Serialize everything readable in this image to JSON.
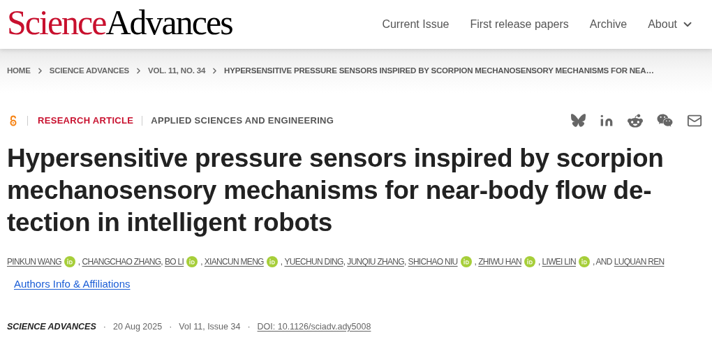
{
  "logo": {
    "part_1": "Science",
    "part_2": "Advances"
  },
  "nav": [
    {
      "label": "Current Issue",
      "dropdown": false
    },
    {
      "label": "First release papers",
      "dropdown": false
    },
    {
      "label": "Archive",
      "dropdown": false
    },
    {
      "label": "About",
      "dropdown": true
    }
  ],
  "breadcrumb": [
    "HOME",
    "SCIENCE ADVANCES",
    "VOL. 11, NO. 34",
    "HYPERSENSITIVE PRESSURE SENSORS INSPIRED BY SCORPION MECHANOSENSORY MECHANISMS FOR NEA…"
  ],
  "article_type": "RESEARCH ARTICLE",
  "subject": "APPLIED SCIENCES AND ENGINEERING",
  "title": "Hypersensitive pressure sensors inspired by scorpion mechanosensory mechanisms for near-body flow de-tection in intelligent robots",
  "authors": [
    {
      "name": "PINKUN WANG",
      "orcid": true,
      "after": ","
    },
    {
      "name": "CHANGCHAO ZHANG",
      "orcid": false,
      "after": ","
    },
    {
      "name": "BO LI",
      "orcid": true,
      "after": ","
    },
    {
      "name": "XIANCUN MENG",
      "orcid": true,
      "after": ","
    },
    {
      "name": "YUECHUN DING",
      "orcid": false,
      "after": ","
    },
    {
      "name": "JUNQIU ZHANG",
      "orcid": false,
      "after": ","
    },
    {
      "name": "SHICHAO NIU",
      "orcid": true,
      "after": ","
    },
    {
      "name": "ZHIWU HAN",
      "orcid": true,
      "after": ","
    },
    {
      "name": "LIWEI LIN",
      "orcid": true,
      "after": ", AND"
    },
    {
      "name": "LUQUAN REN",
      "orcid": false
    }
  ],
  "affiliations_link": "Authors Info & Affiliations",
  "citation": [
    {
      "kind": "journal",
      "text": "SCIENCE ADVANCES"
    },
    {
      "kind": "dot",
      "text": "·"
    },
    {
      "kind": "date",
      "text": "20 Aug 2025"
    },
    {
      "kind": "dot",
      "text": "·"
    },
    {
      "kind": "volume",
      "text": "Vol 11, Issue 34"
    },
    {
      "kind": "dot",
      "text": "·"
    },
    {
      "kind": "doi",
      "text": "DOI: 10.1126/sciadv.ady5008"
    }
  ]
}
